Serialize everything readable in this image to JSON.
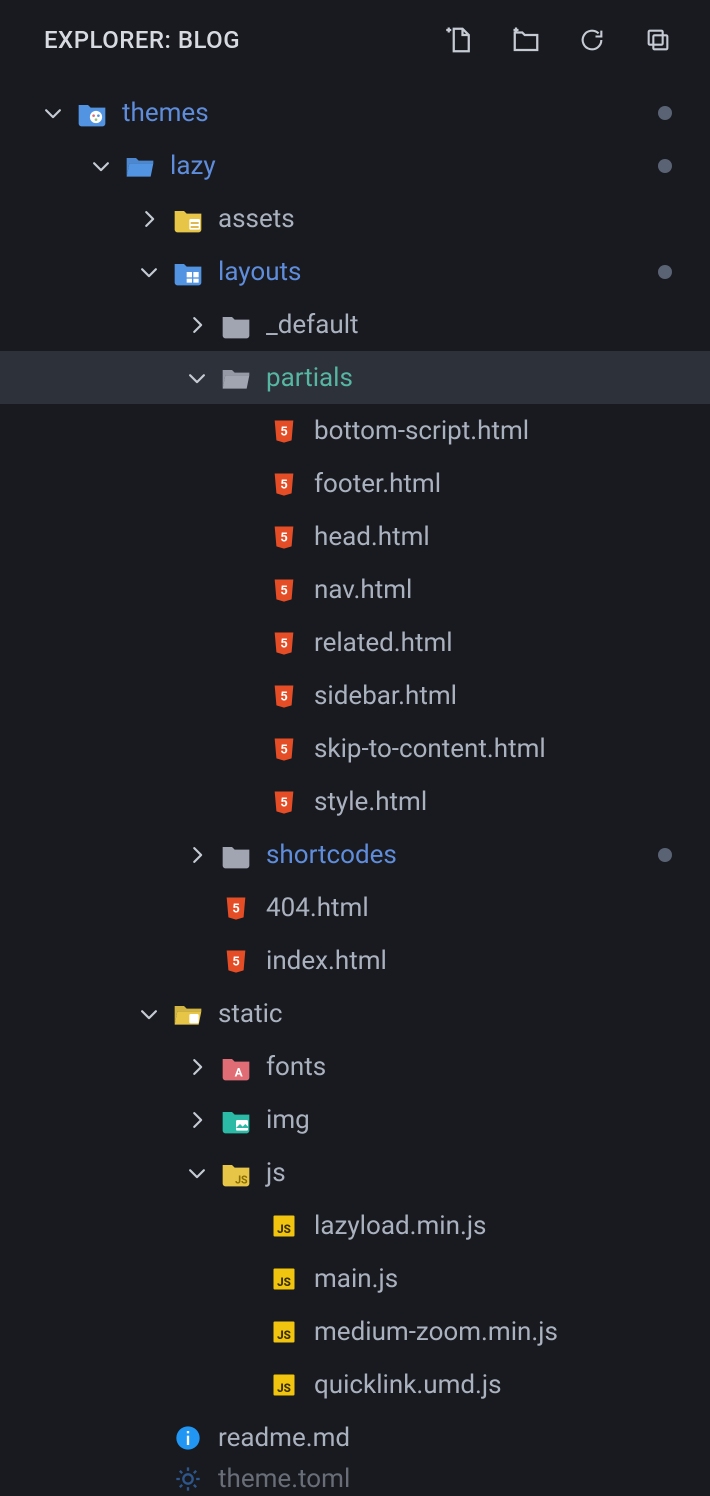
{
  "header": {
    "title": "EXPLORER: BLOG"
  },
  "tree": {
    "themes": "themes",
    "lazy": "lazy",
    "assets": "assets",
    "layouts": "layouts",
    "default": "_default",
    "partials": "partials",
    "bottom": "bottom-script.html",
    "footer": "footer.html",
    "head": "head.html",
    "nav": "nav.html",
    "related": "related.html",
    "sidebar": "sidebar.html",
    "skip": "skip-to-content.html",
    "style": "style.html",
    "shortcodes": "shortcodes",
    "f404": "404.html",
    "index": "index.html",
    "static": "static",
    "fonts": "fonts",
    "img": "img",
    "js": "js",
    "lazyload": "lazyload.min.js",
    "main": "main.js",
    "medium": "medium-zoom.min.js",
    "quicklink": "quicklink.umd.js",
    "readme": "readme.md",
    "themetoml": "theme.toml"
  }
}
